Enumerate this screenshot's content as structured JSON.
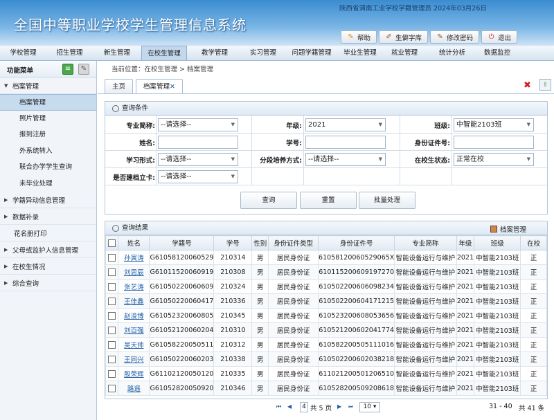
{
  "header": {
    "title": "全国中等职业学校学生管理信息系统",
    "user_info": "陕西省渭南工业学校学籍管理员 2024年03月26日",
    "buttons": [
      {
        "label": "帮助",
        "icon": "help-icon"
      },
      {
        "label": "生僻字库",
        "icon": "charset-icon"
      },
      {
        "label": "修改密码",
        "icon": "key-icon"
      },
      {
        "label": "退出",
        "icon": "power-icon"
      }
    ]
  },
  "nav": {
    "items": [
      "学校管理",
      "招生管理",
      "新生管理",
      "在校生管理",
      "教学管理",
      "实习管理",
      "问题学籍管理",
      "毕业生管理",
      "就业管理",
      "统计分析",
      "数据监控"
    ],
    "active_index": 3
  },
  "sidebar": {
    "title": "功能菜单",
    "sections": [
      {
        "label": "档案管理",
        "expanded": true,
        "items": [
          "档案管理",
          "照片管理",
          "报到注册",
          "外系统转入",
          "联合办学学生查询",
          "未毕业处理"
        ],
        "selected": 0
      },
      {
        "label": "学籍异动信息管理"
      },
      {
        "label": "数据补录"
      },
      {
        "label": "花名册打印",
        "plain": true
      },
      {
        "label": "父母或监护人信息管理"
      },
      {
        "label": "在校生情况"
      },
      {
        "label": "综合查询"
      }
    ]
  },
  "breadcrumb": "当前位置：在校生管理 > 档案管理",
  "tabs": [
    {
      "label": "主页"
    },
    {
      "label": "档案管理",
      "closable": true
    }
  ],
  "query": {
    "title": "查询条件",
    "fields": {
      "major": {
        "label": "专业简称:",
        "value": "--请选择--"
      },
      "grade": {
        "label": "年级:",
        "value": "2021"
      },
      "class": {
        "label": "班级:",
        "value": "中智能2103班"
      },
      "name": {
        "label": "姓名:",
        "value": ""
      },
      "student_no": {
        "label": "学号:",
        "value": ""
      },
      "id_no": {
        "label": "身份证件号:",
        "value": ""
      },
      "study_form": {
        "label": "学习形式:",
        "value": "--请选择--"
      },
      "stage_mode": {
        "label": "分段培养方式:",
        "value": "--请选择--"
      },
      "status": {
        "label": "在校生状态:",
        "value": "正常在校"
      },
      "archive": {
        "label": "是否建档立卡:",
        "value": "--请选择--"
      }
    },
    "buttons": [
      "查询",
      "重置",
      "批量处理"
    ]
  },
  "results": {
    "title": "查询结果",
    "action": "档案管理",
    "columns": [
      "姓名",
      "学籍号",
      "学号",
      "性别",
      "身份证件类型",
      "身份证件号",
      "专业简称",
      "年级",
      "班级",
      "在校"
    ],
    "rows": [
      [
        "孙寅涛",
        "G61058120060529",
        "210314",
        "男",
        "居民身份证",
        "61058120060529065X",
        "智能设备运行与维护",
        "2021",
        "中智能2103班",
        "正"
      ],
      [
        "刘思辰",
        "G61011520060919",
        "210308",
        "男",
        "居民身份证",
        "610115200609197270",
        "智能设备运行与维护",
        "2021",
        "中智能2103班",
        "正"
      ],
      [
        "张艺涛",
        "G61050220060609",
        "210324",
        "男",
        "居民身份证",
        "610502200606098234",
        "智能设备运行与维护",
        "2021",
        "中智能2103班",
        "正"
      ],
      [
        "王佳鑫",
        "G61050220060417",
        "210336",
        "男",
        "居民身份证",
        "610502200604171215",
        "智能设备运行与维护",
        "2021",
        "中智能2103班",
        "正"
      ],
      [
        "赵浚博",
        "G61052320060805",
        "210345",
        "男",
        "居民身份证",
        "610523200608053656",
        "智能设备运行与维护",
        "2021",
        "中智能2103班",
        "正"
      ],
      [
        "刘百强",
        "G61052120060204",
        "210310",
        "男",
        "居民身份证",
        "610521200602041774",
        "智能设备运行与维护",
        "2021",
        "中智能2103班",
        "正"
      ],
      [
        "吴天帅",
        "G61058220050511",
        "210312",
        "男",
        "居民身份证",
        "610582200505111016",
        "智能设备运行与维护",
        "2021",
        "中智能2103班",
        "正"
      ],
      [
        "王同兴",
        "G61050220060203",
        "210338",
        "男",
        "居民身份证",
        "610502200602038218",
        "智能设备运行与维护",
        "2021",
        "中智能2103班",
        "正"
      ],
      [
        "殷荣辉",
        "G61102120050120",
        "210335",
        "男",
        "居民身份证",
        "611021200501206510",
        "智能设备运行与维护",
        "2021",
        "中智能2103班",
        "正"
      ],
      [
        "路遥",
        "G61052820050920",
        "210346",
        "男",
        "居民身份证",
        "610528200509208618",
        "智能设备运行与维护",
        "2021",
        "中智能2103班",
        "正"
      ]
    ]
  },
  "pager": {
    "current": "4",
    "total_text": "共 5 页",
    "page_size": "10",
    "range": "31 - 40",
    "total": "共 41 条"
  }
}
